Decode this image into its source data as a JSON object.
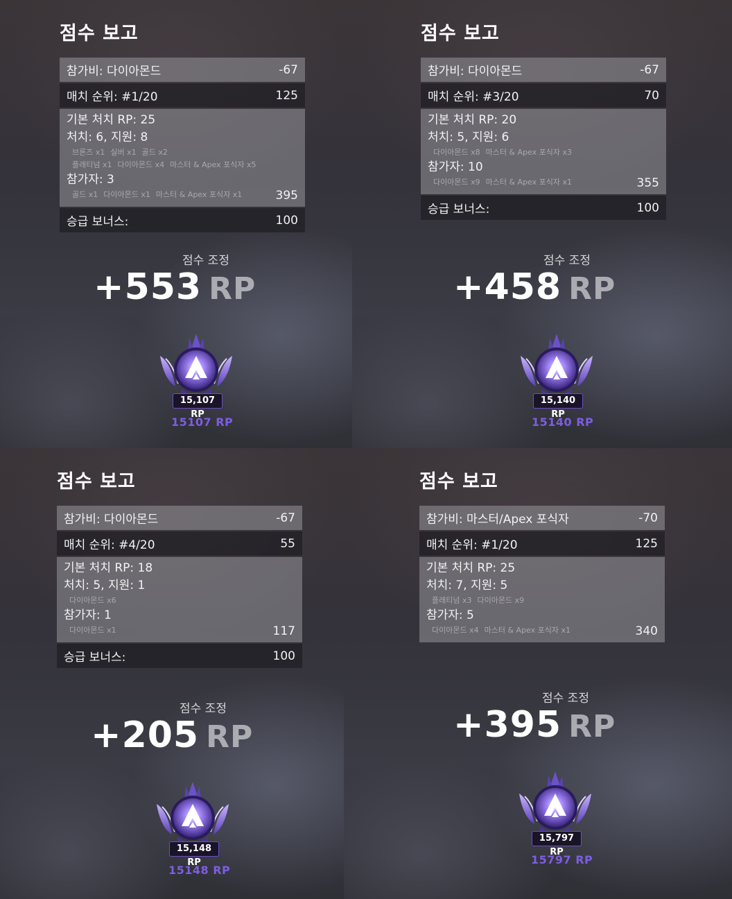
{
  "panels": [
    {
      "title": "점수 보고",
      "entry_label": "참가비: 다이아몬드",
      "entry_value": "-67",
      "placement_label": "매치 순위: #1/20",
      "placement_value": "125",
      "kill_base": "기본 처치 RP: 25",
      "kills_line": "처치: 6, 지원: 8",
      "kills_sub1": [
        "브론즈 x1",
        "실버 x1",
        "골드 x2"
      ],
      "kills_sub2": [
        "플래티넘 x1",
        "다이아몬드 x4",
        "마스터 & Apex 포식자 x5"
      ],
      "participants_line": "참가자: 3",
      "participants_sub": [
        "골드 x1",
        "다이아몬드 x1",
        "마스터 & Apex 포식자 x1"
      ],
      "kills_total": "395",
      "promo_label": "승급 보너스:",
      "promo_value": "100",
      "adj_label": "점수 조정",
      "adj_value": "+553",
      "adj_unit": "RP",
      "badge_rp": "15,107 RP",
      "total_rp": "15107 RP"
    },
    {
      "title": "점수 보고",
      "entry_label": "참가비: 다이아몬드",
      "entry_value": "-67",
      "placement_label": "매치 순위: #3/20",
      "placement_value": "70",
      "kill_base": "기본 처치 RP: 20",
      "kills_line": "처치: 5, 지원: 6",
      "kills_sub1": [
        "다이아몬드 x8",
        "마스터 & Apex 포식자 x3"
      ],
      "participants_line": "참가자: 10",
      "participants_sub": [
        "다이아몬드 x9",
        "마스터 & Apex 포식자 x1"
      ],
      "kills_total": "355",
      "promo_label": "승급 보너스:",
      "promo_value": "100",
      "adj_label": "점수 조정",
      "adj_value": "+458",
      "adj_unit": "RP",
      "badge_rp": "15,140 RP",
      "total_rp": "15140 RP"
    },
    {
      "title": "점수 보고",
      "entry_label": "참가비: 다이아몬드",
      "entry_value": "-67",
      "placement_label": "매치 순위: #4/20",
      "placement_value": "55",
      "kill_base": "기본 처치 RP: 18",
      "kills_line": "처치: 5, 지원: 1",
      "kills_sub1": [
        "다이아몬드 x6"
      ],
      "participants_line": "참가자: 1",
      "participants_sub": [
        "다이아몬드 x1"
      ],
      "kills_total": "117",
      "promo_label": "승급 보너스:",
      "promo_value": "100",
      "adj_label": "점수 조정",
      "adj_value": "+205",
      "adj_unit": "RP",
      "badge_rp": "15,148 RP",
      "total_rp": "15148 RP"
    },
    {
      "title": "점수 보고",
      "entry_label": "참가비: 마스터/Apex 포식자",
      "entry_value": "-70",
      "placement_label": "매치 순위: #1/20",
      "placement_value": "125",
      "kill_base": "기본 처치 RP: 25",
      "kills_line": "처치: 7, 지원: 5",
      "kills_sub1": [
        "플래티넘 x3",
        "다이아몬드 x9"
      ],
      "participants_line": "참가자: 5",
      "participants_sub": [
        "다이아몬드 x4",
        "마스터 & Apex 포식자 x1"
      ],
      "kills_total": "340",
      "adj_label": "점수 조정",
      "adj_value": "+395",
      "adj_unit": "RP",
      "badge_rp": "15,797 RP",
      "total_rp": "15797 RP"
    }
  ],
  "colors": {
    "rank_purple": "#7d5ee0",
    "badge_purple": "#8a63ff"
  },
  "icons": {
    "rank_badge": "apex-master-rank-icon"
  }
}
